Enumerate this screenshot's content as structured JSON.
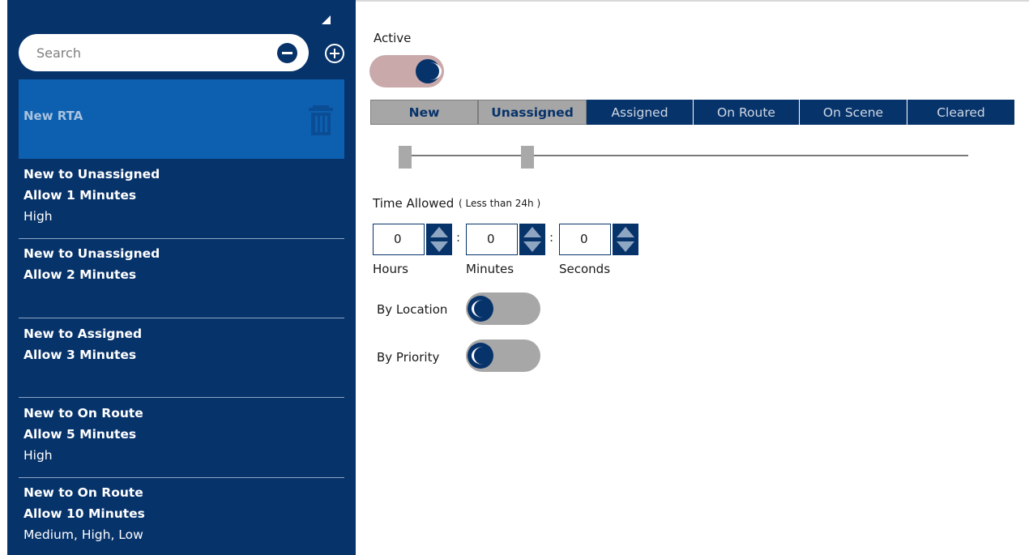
{
  "sidebar": {
    "search": {
      "placeholder": "Search",
      "value": ""
    },
    "selected_item": {
      "title": "New RTA"
    },
    "items": [
      {
        "title": "New to Unassigned",
        "allow": "Allow 1 Minutes",
        "priority": "High"
      },
      {
        "title": "New to Unassigned",
        "allow": "Allow 2 Minutes",
        "priority": ""
      },
      {
        "title": "New to Assigned",
        "allow": "Allow 3 Minutes",
        "priority": ""
      },
      {
        "title": "New to On Route",
        "allow": "Allow 5 Minutes",
        "priority": "High"
      },
      {
        "title": "New to On Route",
        "allow": "Allow 10 Minutes",
        "priority": "Medium, High, Low"
      }
    ]
  },
  "main": {
    "active_label": "Active",
    "active_on": true,
    "tabs": [
      {
        "label": "New",
        "state": "done"
      },
      {
        "label": "Unassigned",
        "state": "done"
      },
      {
        "label": "Assigned",
        "state": "todo"
      },
      {
        "label": "On Route",
        "state": "todo"
      },
      {
        "label": "On Scene",
        "state": "todo"
      },
      {
        "label": "Cleared",
        "state": "todo"
      }
    ],
    "time_allowed_label": "Time Allowed",
    "time_allowed_hint": "( Less than 24h )",
    "time": {
      "hours": "0",
      "minutes": "0",
      "seconds": "0",
      "hours_label": "Hours",
      "minutes_label": "Minutes",
      "seconds_label": "Seconds",
      "separator": ":"
    },
    "by_location_label": "By Location",
    "by_location_on": false,
    "by_priority_label": "By Priority",
    "by_priority_on": false
  },
  "colors": {
    "navy": "#07336b",
    "selected_blue": "#0d5fb0",
    "tab_done": "#a6a6a6",
    "toggle_on": "#c9a9a9",
    "toggle_off": "#a7a7a7"
  }
}
